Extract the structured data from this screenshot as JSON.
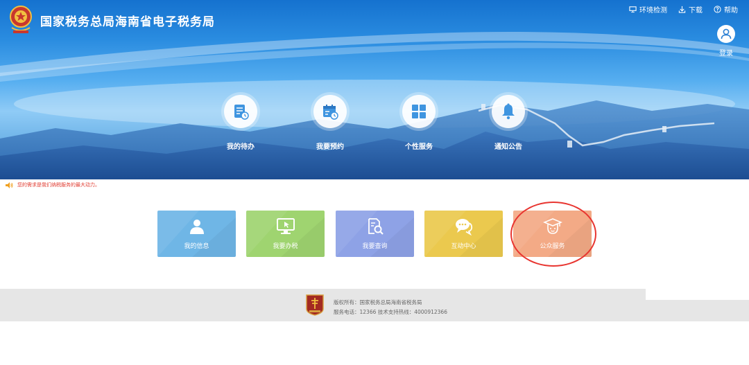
{
  "header": {
    "title": "国家税务总局海南省电子税务局",
    "links": [
      {
        "label": "环境检测",
        "icon": "monitor-icon"
      },
      {
        "label": "下载",
        "icon": "download-icon"
      },
      {
        "label": "帮助",
        "icon": "help-icon"
      }
    ],
    "login_label": "登录"
  },
  "quick_nav": [
    {
      "label": "我的待办",
      "icon": "todo-list-icon"
    },
    {
      "label": "我要预约",
      "icon": "calendar-clock-icon"
    },
    {
      "label": "个性服务",
      "icon": "grid-icon"
    },
    {
      "label": "通知公告",
      "icon": "bell-icon"
    }
  ],
  "notice": {
    "text": "您的需求是我们纳税服务的最大动力。",
    "color": "#e03a2f"
  },
  "tiles": [
    {
      "label": "我的信息",
      "icon": "user-icon",
      "color": "#6fb6e6"
    },
    {
      "label": "我要办税",
      "icon": "computer-icon",
      "color": "#9fd470"
    },
    {
      "label": "我要查询",
      "icon": "document-search-icon",
      "color": "#8ea2e6"
    },
    {
      "label": "互动中心",
      "icon": "chat-bubbles-icon",
      "color": "#ebc94e"
    },
    {
      "label": "公众服务",
      "icon": "graduate-icon",
      "color": "#f3aa86"
    }
  ],
  "footer": {
    "line1": "版权所有：国家税务总局海南省税务局",
    "line2": "服务电话：12366 技术支持热线：4000912366"
  },
  "colors": {
    "banner": "#2a8ce0",
    "footer_bg": "#e6e6e6",
    "highlight": "#e8342f"
  }
}
